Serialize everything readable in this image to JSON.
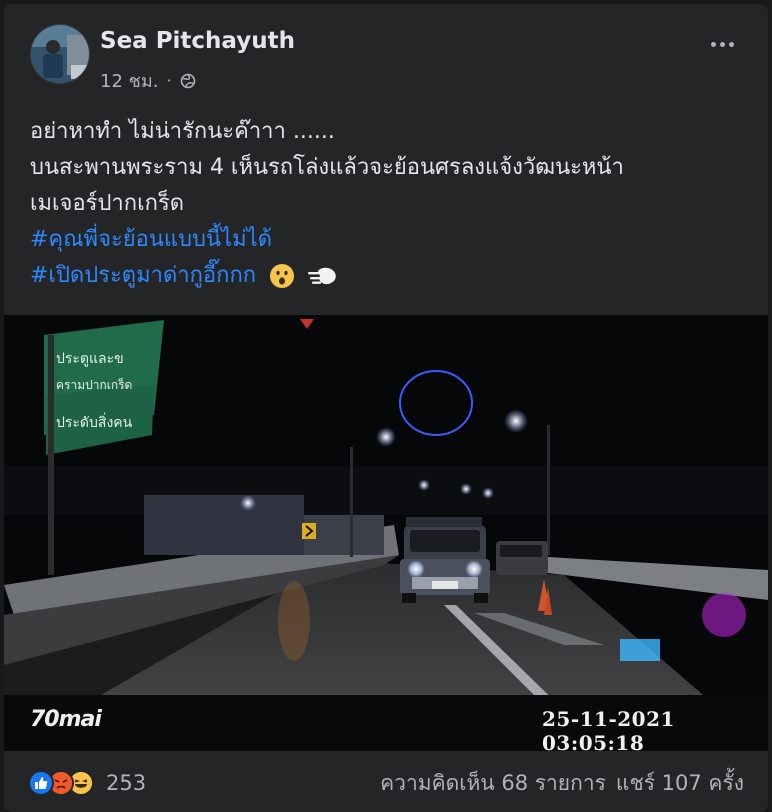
{
  "post": {
    "author": "Sea Pitchayuth",
    "time": "12 ชม.",
    "separator": "·",
    "privacy_icon": "globe-icon",
    "more_icon": "more-options-icon",
    "text_lines": [
      "อย่าหาทำ ไม่น่ารักนะค๊าาา ......",
      "บนสะพานพระราม 4 เห็นรถโล่งแล้วจะย้อนศรลงแจ้งวัฒนะหน้า",
      "เมเจอร์ปากเกร็ด"
    ],
    "hashtags": [
      "#คุณพี่จะย้อนแบบนี้ไม่ได้",
      "#เปิดประตูมาด่ากูอี๊กกก"
    ],
    "emojis": [
      "open-mouth-emoji",
      "dash-emoji"
    ]
  },
  "media": {
    "brand": "70mai",
    "timestamp": "25-11-2021 03:05:18",
    "sign_text_1": "ประตูและข",
    "sign_text_2": "ครามปากเกร็ด",
    "sign_text_3": "ประดับสิ่งคน"
  },
  "stats": {
    "reaction_icons": [
      "like-reaction-icon",
      "angry-reaction-icon",
      "haha-reaction-icon"
    ],
    "reaction_count": "253",
    "comments": "ความคิดเห็น 68 รายการ",
    "shares": "แชร์ 107 ครั้ง"
  },
  "colors": {
    "background": "#18191a",
    "card": "#242526",
    "text": "#e4e6eb",
    "secondary": "#b0b3b8",
    "link": "#2d88ff"
  }
}
